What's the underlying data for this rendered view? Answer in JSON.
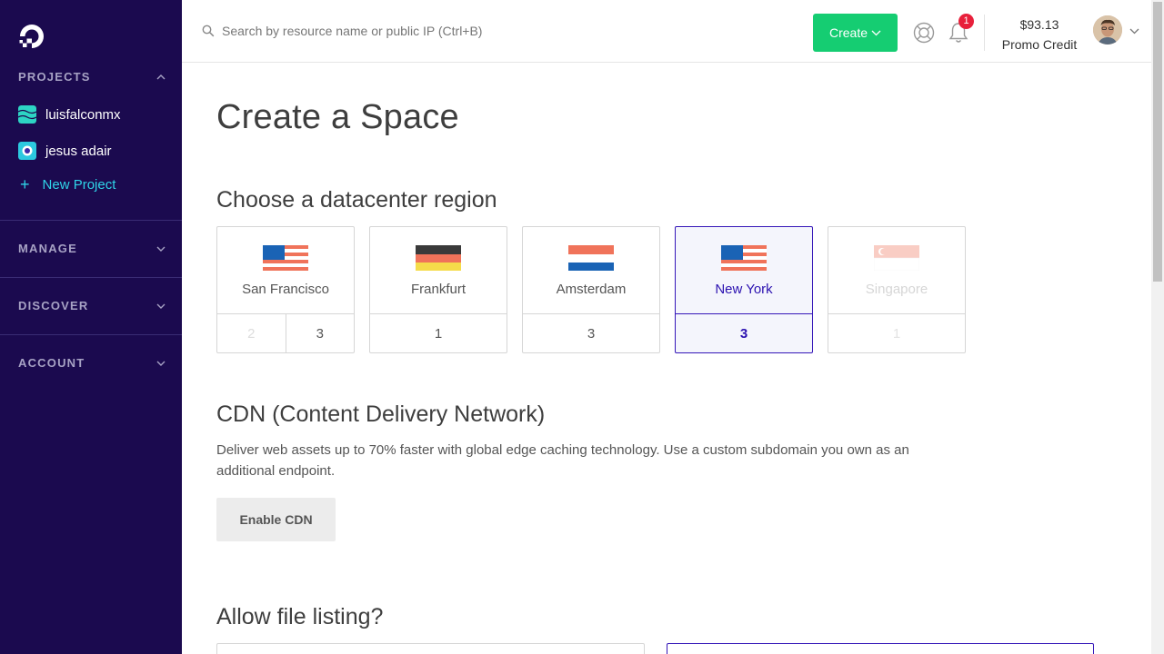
{
  "sidebar": {
    "projects_heading": "PROJECTS",
    "projects": [
      {
        "label": "luisfalconmx"
      },
      {
        "label": "jesus adair"
      }
    ],
    "new_project": "New Project",
    "manage_heading": "MANAGE",
    "discover_heading": "DISCOVER",
    "account_heading": "ACCOUNT"
  },
  "header": {
    "search_placeholder": "Search by resource name or public IP (Ctrl+B)",
    "create_label": "Create",
    "notification_count": "1",
    "credit_amount": "$93.13",
    "credit_label": "Promo Credit"
  },
  "main": {
    "page_title": "Create a Space",
    "region_heading": "Choose a datacenter region",
    "regions": [
      {
        "name": "San Francisco",
        "numbers": [
          "2",
          "3"
        ],
        "flag": "us-flag-icon",
        "state": "normal"
      },
      {
        "name": "Frankfurt",
        "numbers": [
          "1"
        ],
        "flag": "de-flag-icon",
        "state": "normal"
      },
      {
        "name": "Amsterdam",
        "numbers": [
          "3"
        ],
        "flag": "nl-flag-icon",
        "state": "normal"
      },
      {
        "name": "New York",
        "numbers": [
          "3"
        ],
        "flag": "us-flag-icon",
        "state": "selected"
      },
      {
        "name": "Singapore",
        "numbers": [
          "1"
        ],
        "flag": "sg-flag-icon",
        "state": "disabled"
      }
    ],
    "cdn_heading": "CDN (Content Delivery Network)",
    "cdn_description": "Deliver web assets up to 70% faster with global edge caching technology. Use a custom subdomain you own as an additional endpoint.",
    "cdn_button": "Enable CDN",
    "file_listing_heading": "Allow file listing?"
  },
  "colors": {
    "sidebar_bg": "#1b0a4f",
    "create_green": "#15cd72",
    "selected_accent": "#3416b8",
    "badge_red": "#e8203b"
  }
}
